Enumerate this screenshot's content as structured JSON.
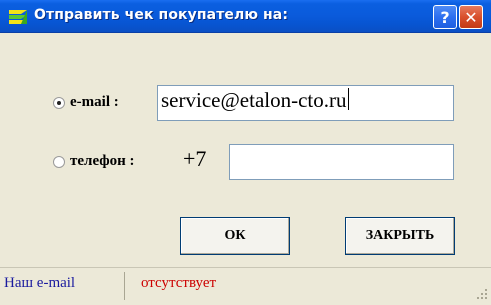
{
  "window": {
    "title": "Отправить чек покупателю на:",
    "help_label": "?",
    "close_label": "✕"
  },
  "form": {
    "email": {
      "label": "e-mail :",
      "selected": true,
      "value": "service@etalon-cto.ru"
    },
    "phone": {
      "label": "телефон :",
      "selected": false,
      "prefix": "+7",
      "value": ""
    }
  },
  "buttons": {
    "ok_label": "ОК",
    "close_label": "ЗАКРЫТЬ"
  },
  "status": {
    "left": "Наш e-mail",
    "right": "отсутствует"
  },
  "colors": {
    "titlebar": "#0a5bdc",
    "status_left": "#1a1a9e",
    "status_right": "#cc0000"
  }
}
